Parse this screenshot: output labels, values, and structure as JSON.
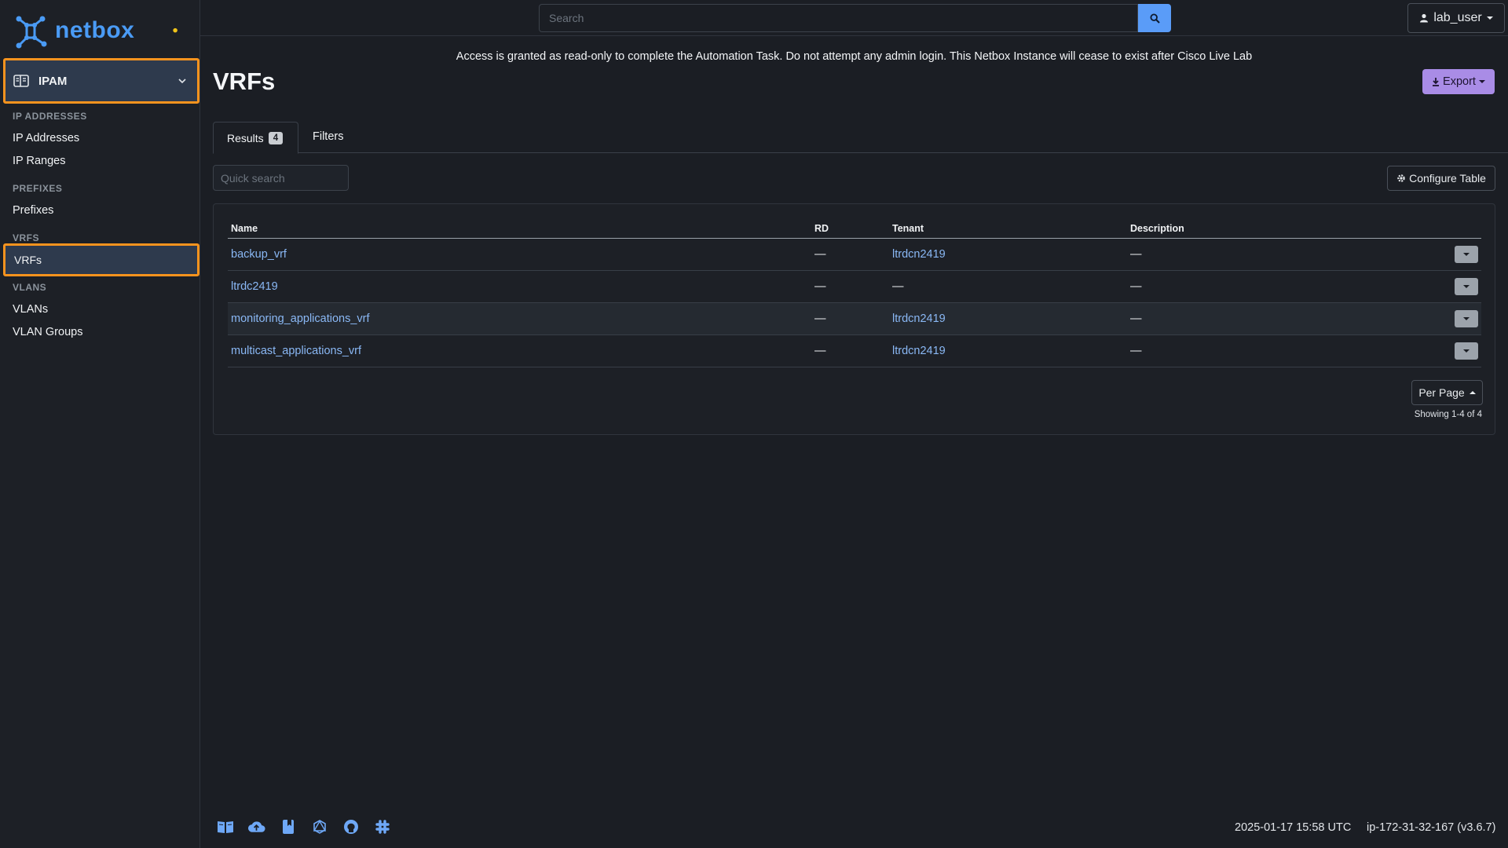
{
  "brand": {
    "name": "netbox",
    "accent": "#4a9bf5"
  },
  "sidebar": {
    "menu_label": "IPAM",
    "groups": [
      {
        "heading": "IP ADDRESSES",
        "items": [
          "IP Addresses",
          "IP Ranges"
        ]
      },
      {
        "heading": "PREFIXES",
        "items": [
          "Prefixes"
        ]
      },
      {
        "heading": "VRFS",
        "items": [
          "VRFs"
        ]
      },
      {
        "heading": "VLANS",
        "items": [
          "VLANs",
          "VLAN Groups"
        ]
      }
    ],
    "active_item": "VRFs",
    "highlight_color": "#f7931e"
  },
  "topbar": {
    "search_placeholder": "Search",
    "user": "lab_user"
  },
  "banner": "Access is granted as read-only to complete the Automation Task. Do not attempt any admin login. This Netbox Instance will cease to exist after Cisco Live Lab",
  "page": {
    "title": "VRFs",
    "export_label": "Export",
    "tabs": {
      "results_label": "Results",
      "results_count": "4",
      "filters_label": "Filters"
    },
    "quick_search_placeholder": "Quick search",
    "configure_label": "Configure Table"
  },
  "table": {
    "headers": {
      "name": "Name",
      "rd": "RD",
      "tenant": "Tenant",
      "description": "Description"
    },
    "rows": [
      {
        "name": "backup_vrf",
        "rd": "—",
        "tenant": "ltrdcn2419",
        "description": "—"
      },
      {
        "name": "ltrdc2419",
        "rd": "—",
        "tenant": "—",
        "description": "—"
      },
      {
        "name": "monitoring_applications_vrf",
        "rd": "—",
        "tenant": "ltrdcn2419",
        "description": "—"
      },
      {
        "name": "multicast_applications_vrf",
        "rd": "—",
        "tenant": "ltrdcn2419",
        "description": "—"
      }
    ],
    "per_page_label": "Per Page",
    "showing": "Showing 1-4 of 4"
  },
  "footer": {
    "timestamp": "2025-01-17 15:58 UTC",
    "host": "ip-172-31-32-167 (v3.6.7)",
    "icons": [
      "docs-icon",
      "cloud-icon",
      "bookmark-icon",
      "graphql-icon",
      "github-icon",
      "slack-icon"
    ]
  }
}
